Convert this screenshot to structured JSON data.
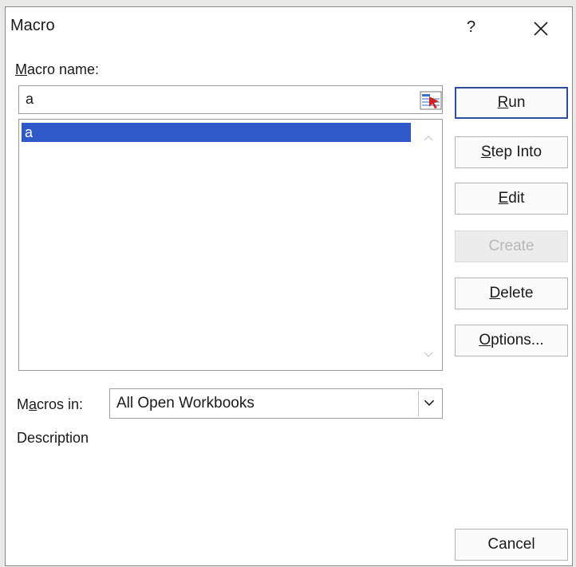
{
  "dialog": {
    "title": "Macro",
    "help_label": "?",
    "close_icon": "close-icon"
  },
  "macro_name": {
    "label_ul": "M",
    "label_rest": "acro name:",
    "value": "a",
    "picker_icon": "range-picker-icon"
  },
  "macro_list": {
    "items": [
      "a"
    ],
    "selected": "a",
    "selection_color": "#2f58c8"
  },
  "buttons": {
    "run_ul": "R",
    "run_rest": "un",
    "step_into_ul": "S",
    "step_into_rest": "tep Into",
    "edit_ul": "E",
    "edit_rest": "dit",
    "create": "Create",
    "delete_ul": "D",
    "delete_rest": "elete",
    "options_ul": "O",
    "options_rest": "ptions...",
    "cancel": "Cancel"
  },
  "macros_in": {
    "label_pre": "M",
    "label_ul": "a",
    "label_post": "cros in:",
    "value": "All Open Workbooks",
    "dropdown_icon": "chevron-down-icon"
  },
  "description": {
    "label": "Description"
  }
}
